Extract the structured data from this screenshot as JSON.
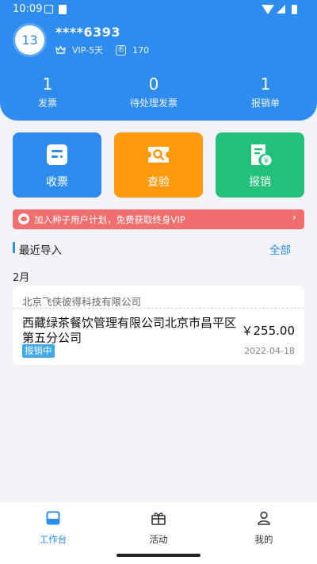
{
  "status_bar": {
    "time": "10:09"
  },
  "profile": {
    "avatar_text": "13",
    "phone": "****6393",
    "vip": "VIP-5天",
    "coin_icon_glyph": "币",
    "coins": "170"
  },
  "stats": [
    {
      "value": "1",
      "label": "发票"
    },
    {
      "value": "0",
      "label": "待处理发票"
    },
    {
      "value": "1",
      "label": "报销单"
    }
  ],
  "actions": [
    {
      "label": "收票",
      "color": "#2d8cee",
      "icon": "invoice-collect-icon"
    },
    {
      "label": "查验",
      "color": "#ff9a0f",
      "icon": "inspect-ticket-icon"
    },
    {
      "label": "报销",
      "color": "#21c17a",
      "icon": "reimburse-icon"
    }
  ],
  "banner": {
    "text": "加入种子用户计划，免费获取终身VIP",
    "chevron": "›"
  },
  "recent": {
    "title": "最近导入",
    "all_label": "全部",
    "month": "2月",
    "invoice": {
      "seller": "北京飞侠彼得科技有限公司",
      "buyer": "西藏绿茶餐饮管理有限公司北京市昌平区第五分公司",
      "amount": "￥255.00",
      "status": "报销中",
      "date": "2022-04-18"
    }
  },
  "nav": [
    {
      "label": "工作台",
      "icon": "workbench-icon",
      "active": true
    },
    {
      "label": "活动",
      "icon": "gift-icon",
      "active": false
    },
    {
      "label": "我的",
      "icon": "person-icon",
      "active": false
    }
  ],
  "colors": {
    "primary": "#2d8cee",
    "banner": "#f06e6e",
    "status_badge": "#42a8ec"
  }
}
